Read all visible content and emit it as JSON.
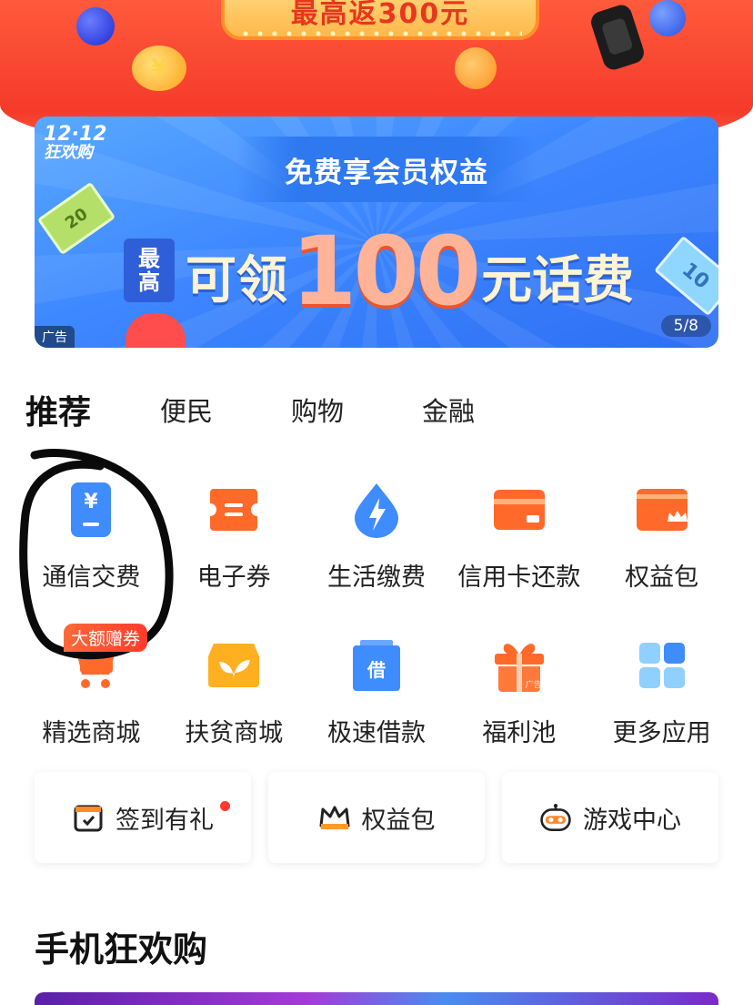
{
  "top_banner": {
    "promo_text": "最高返300元"
  },
  "ad_banner": {
    "badge_line1": "12·12",
    "badge_line2": "狂欢购",
    "subtitle": "免费享会员权益",
    "max_line1": "最",
    "max_line2": "高",
    "headline_pre": "可领",
    "headline_num": "100",
    "headline_post": "元话费",
    "ad_tag": "广告",
    "pager": "5/8",
    "bill_left": "20",
    "bill_right": "10"
  },
  "tabs": [
    {
      "label": "推荐",
      "active": true
    },
    {
      "label": "便民",
      "active": false
    },
    {
      "label": "购物",
      "active": false
    },
    {
      "label": "金融",
      "active": false
    }
  ],
  "grid": {
    "items": [
      {
        "label": "通信交费",
        "icon": "phone-bill-icon"
      },
      {
        "label": "电子券",
        "icon": "ticket-icon"
      },
      {
        "label": "生活缴费",
        "icon": "electric-icon"
      },
      {
        "label": "信用卡还款",
        "icon": "credit-card-icon"
      },
      {
        "label": "权益包",
        "icon": "benefit-card-icon"
      },
      {
        "label": "精选商城",
        "icon": "cart-icon",
        "ribbon": "大额赠券"
      },
      {
        "label": "扶贫商城",
        "icon": "sprout-shop-icon"
      },
      {
        "label": "极速借款",
        "icon": "loan-icon",
        "icon_text": "借"
      },
      {
        "label": "福利池",
        "icon": "gift-icon",
        "icon_text": "广告"
      },
      {
        "label": "更多应用",
        "icon": "more-apps-icon"
      }
    ]
  },
  "cards": [
    {
      "label": "签到有礼",
      "icon": "calendar-check-icon"
    },
    {
      "label": "权益包",
      "icon": "crown-icon"
    },
    {
      "label": "游戏中心",
      "icon": "game-robot-icon"
    }
  ],
  "section": {
    "title": "手机狂欢购"
  },
  "colors": {
    "accent_orange": "#ff6a2a",
    "brand_blue": "#3d87ff",
    "brand_red": "#f53a2a"
  }
}
